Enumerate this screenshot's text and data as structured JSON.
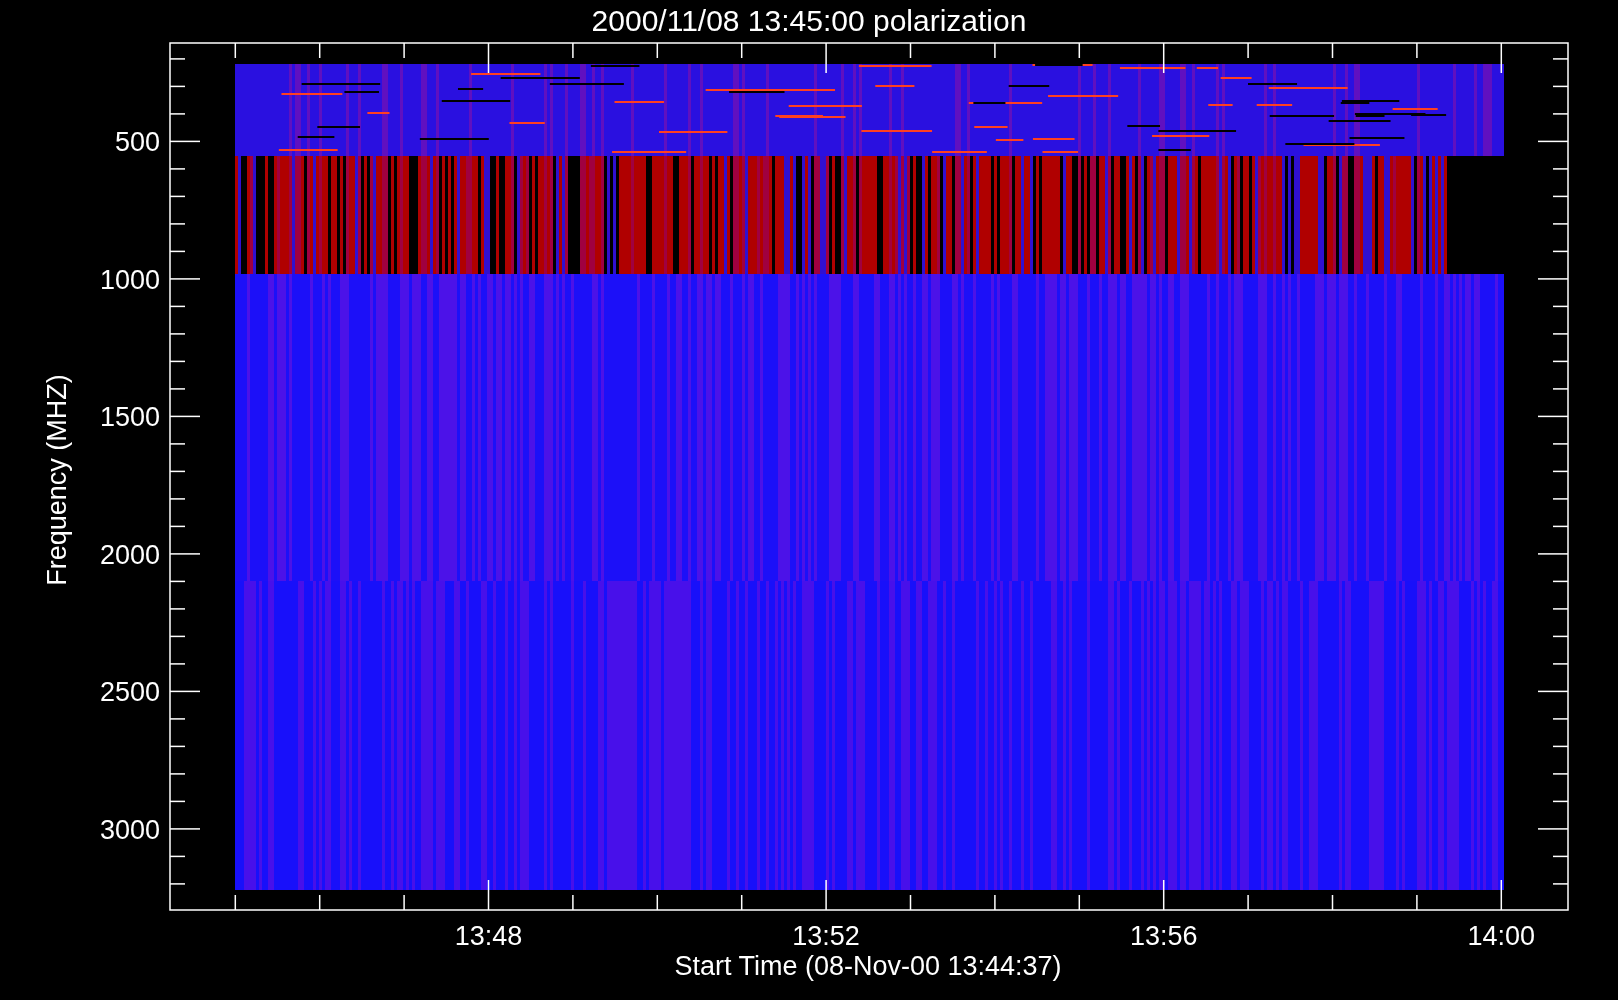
{
  "title": "2000/11/08 13:45:00 polarization",
  "y_axis": {
    "label": "Frequency (MHZ)",
    "ticks": [
      "500",
      "1000",
      "1500",
      "2000",
      "2500",
      "3000"
    ]
  },
  "x_axis": {
    "label": "Start Time (08-Nov-00 13:44:37)",
    "ticks": [
      "13:48",
      "13:52",
      "13:56",
      "14:00"
    ]
  }
}
